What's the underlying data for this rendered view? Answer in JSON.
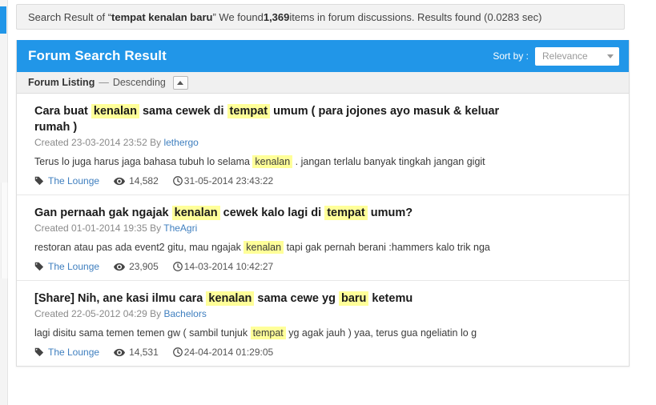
{
  "search_summary": {
    "prefix": "Search Result of “",
    "query": "tempat kenalan baru",
    "middle": "” We found ",
    "count": "1,369",
    "suffix": " items in forum discussions. Results found (0.0283 sec)"
  },
  "panel": {
    "title": "Forum Search Result",
    "sort_label": "Sort by :",
    "sort_value": "Relevance",
    "sort_options": [
      "Relevance"
    ],
    "listing_label": "Forum Listing",
    "listing_dash": "—",
    "listing_direction": "Descending",
    "sort_toggle_icon": "caret-up-icon"
  },
  "colors": {
    "accent_blue": "#2196e8",
    "highlight_yellow": "#ffff99",
    "link_blue": "#3f7fbf",
    "panel_border": "#dddddd",
    "summary_bg": "#f2f2f2"
  },
  "results": [
    {
      "title_parts": [
        {
          "text": "Cara buat ",
          "hl": false
        },
        {
          "text": "kenalan",
          "hl": true
        },
        {
          "text": " sama cewek di ",
          "hl": false
        },
        {
          "text": "tempat",
          "hl": true
        },
        {
          "text": " umum ( para jojones ayo masuk & keluar rumah )",
          "hl": false
        }
      ],
      "created_label": "Created",
      "created_date": "23-03-2014 23:52",
      "by_label": "By",
      "author": "lethergo",
      "snippet_parts": [
        {
          "text": "Terus lo juga harus jaga bahasa tubuh lo selama ",
          "hl": false
        },
        {
          "text": "kenalan",
          "hl": true
        },
        {
          "text": " . jangan terlalu banyak tingkah jangan gigit",
          "hl": false
        }
      ],
      "forum": "The Lounge",
      "views": "14,582",
      "timestamp": "31-05-2014 23:43:22"
    },
    {
      "title_parts": [
        {
          "text": "Gan pernaah gak ngajak ",
          "hl": false
        },
        {
          "text": "kenalan",
          "hl": true
        },
        {
          "text": " cewek kalo lagi di ",
          "hl": false
        },
        {
          "text": "tempat",
          "hl": true
        },
        {
          "text": " umum?",
          "hl": false
        }
      ],
      "created_label": "Created",
      "created_date": "01-01-2014 19:35",
      "by_label": "By",
      "author": "TheAgri",
      "snippet_parts": [
        {
          "text": "restoran atau pas ada event2 gitu, mau ngajak ",
          "hl": false
        },
        {
          "text": "kenalan",
          "hl": true
        },
        {
          "text": " tapi gak pernah berani :hammers kalo trik nga",
          "hl": false
        }
      ],
      "forum": "The Lounge",
      "views": "23,905",
      "timestamp": "14-03-2014 10:42:27"
    },
    {
      "title_parts": [
        {
          "text": "[Share] Nih, ane kasi ilmu cara ",
          "hl": false
        },
        {
          "text": "kenalan",
          "hl": true
        },
        {
          "text": " sama cewe yg ",
          "hl": false
        },
        {
          "text": "baru",
          "hl": true
        },
        {
          "text": " ketemu",
          "hl": false
        }
      ],
      "created_label": "Created",
      "created_date": "22-05-2012 04:29",
      "by_label": "By",
      "author": "Bachelors",
      "snippet_parts": [
        {
          "text": "lagi disitu sama temen temen gw ( sambil tunjuk ",
          "hl": false
        },
        {
          "text": "tempat",
          "hl": true
        },
        {
          "text": " yg agak jauh ) yaa, terus gua ngeliatin lo g",
          "hl": false
        }
      ],
      "forum": "The Lounge",
      "views": "14,531",
      "timestamp": "24-04-2014 01:29:05"
    }
  ],
  "icons": {
    "tag": "tag-icon",
    "eye": "eye-icon",
    "clock": "clock-icon"
  }
}
